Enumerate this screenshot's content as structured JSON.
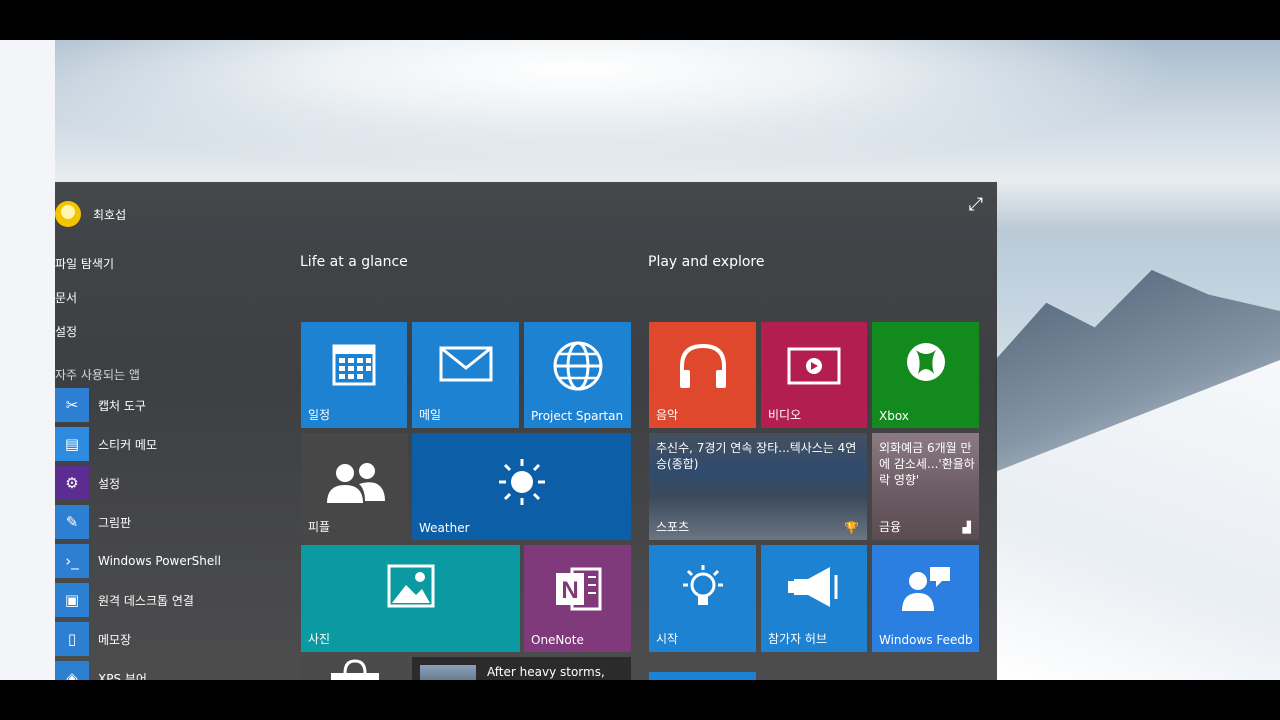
{
  "user": {
    "name": "최호섭"
  },
  "nav_links": [
    "파일 탐색기",
    "문서",
    "설정"
  ],
  "most_used_title": "자주 사용되는 앱",
  "apps": [
    {
      "label": "캡처 도구",
      "color": "#2d7fd2",
      "icon": "scissors-icon"
    },
    {
      "label": "스티커 메모",
      "color": "#2d8ce0",
      "icon": "sticky-note-icon"
    },
    {
      "label": "설정",
      "color": "#5c2d91",
      "icon": "gear-icon"
    },
    {
      "label": "그림판",
      "color": "#2d7fd2",
      "icon": "paint-icon"
    },
    {
      "label": "Windows PowerShell",
      "color": "#2d7fd2",
      "icon": "powershell-icon"
    },
    {
      "label": "원격 데스크톱 연결",
      "color": "#2d7fd2",
      "icon": "remote-desktop-icon"
    },
    {
      "label": "메모장",
      "color": "#2d7fd2",
      "icon": "notepad-icon"
    },
    {
      "label": "XPS 뷰어",
      "color": "#2d7fd2",
      "icon": "xps-icon"
    }
  ],
  "groups": {
    "life": "Life at a glance",
    "play": "Play and explore"
  },
  "tiles": {
    "calendar": {
      "label": "일정",
      "color": "#1e82d2"
    },
    "mail": {
      "label": "메일",
      "color": "#1e82d2"
    },
    "spartan": {
      "label": "Project Spartan",
      "color": "#1e82d2"
    },
    "people": {
      "label": "피플",
      "color": "#474747"
    },
    "weather": {
      "label": "Weather",
      "color": "#0c5fa6"
    },
    "photos": {
      "label": "사진",
      "color": "#0c9aa2"
    },
    "onenote": {
      "label": "OneNote",
      "color": "#80397b"
    },
    "store": {
      "label": "",
      "color": "#4a4a4a"
    },
    "news": {
      "text": "After heavy storms, forecasters predict more to come",
      "color": "#2b2b2b"
    },
    "music": {
      "label": "음악",
      "color": "#e0482e"
    },
    "video": {
      "label": "비디오",
      "color": "#b21e4f"
    },
    "xbox": {
      "label": "Xbox",
      "color": "#128a1e"
    },
    "sports": {
      "label": "스포츠",
      "headline": "추신수, 7경기 연속 장타...텍사스는 4연승(종합)"
    },
    "money": {
      "label": "금융",
      "headline": "외화예금 6개월 만에 감소세...'환율하락 영향'"
    },
    "tips": {
      "label": "시작",
      "color": "#1e82d2"
    },
    "insider": {
      "label": "참가자 허브",
      "color": "#1e82d2"
    },
    "feedback": {
      "label": "Windows Feedb",
      "color": "#2b7fe0"
    }
  }
}
